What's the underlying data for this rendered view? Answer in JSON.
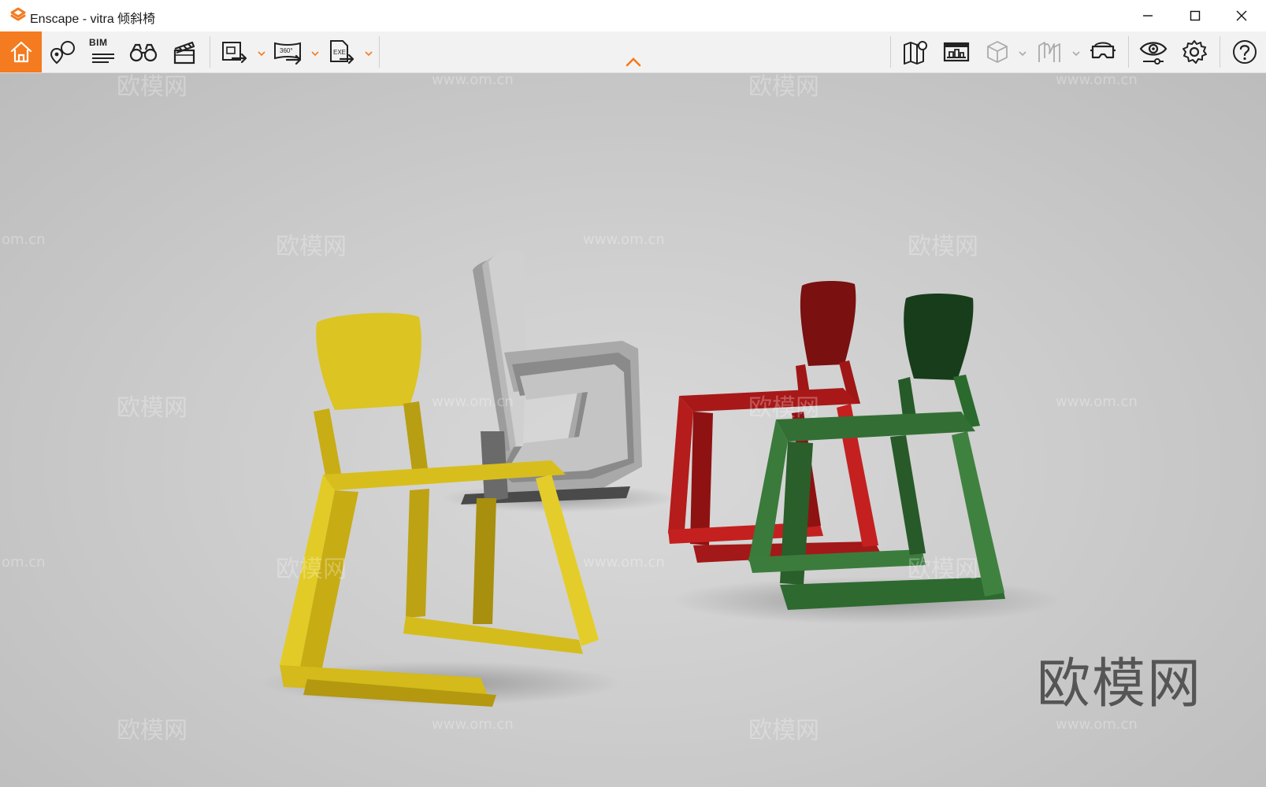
{
  "window": {
    "title": "Enscape - vitra 倾斜椅",
    "controls": [
      "minimize",
      "maximize",
      "close"
    ]
  },
  "toolbar": {
    "bim_label": "BIM",
    "left_tools": [
      {
        "name": "home-button",
        "icon": "home-icon",
        "active": true
      },
      {
        "name": "views-button",
        "icon": "map-pin-icon"
      },
      {
        "name": "bim-button",
        "icon": "bim-icon"
      },
      {
        "name": "binoculars-button",
        "icon": "binoculars-icon"
      },
      {
        "name": "video-editor-button",
        "icon": "clapperboard-icon"
      },
      {
        "name": "export-image-button",
        "icon": "export-image-icon",
        "dropdown": true
      },
      {
        "name": "export-360-button",
        "icon": "panorama-360-icon",
        "dropdown": true
      },
      {
        "name": "export-exe-button",
        "icon": "export-exe-icon",
        "dropdown": true
      }
    ],
    "right_tools": [
      {
        "name": "map-button",
        "icon": "map-icon"
      },
      {
        "name": "asset-library-button",
        "icon": "asset-library-icon"
      },
      {
        "name": "cube-view-button",
        "icon": "cube-icon",
        "dropdown": true,
        "disabled": true
      },
      {
        "name": "section-button",
        "icon": "section-icon",
        "dropdown": true,
        "disabled": true
      },
      {
        "name": "vr-headset-button",
        "icon": "vr-headset-icon"
      },
      {
        "name": "visual-settings-button",
        "icon": "eye-icon"
      },
      {
        "name": "settings-button",
        "icon": "gear-icon"
      },
      {
        "name": "help-button",
        "icon": "help-icon"
      }
    ],
    "accent_color": "#f47b20"
  },
  "viewport": {
    "watermark_text": "欧模网",
    "watermark_url": "www.om.cn",
    "watermark_url_partial": "om.cn",
    "big_watermark": "欧模网",
    "chairs": [
      {
        "color_name": "yellow",
        "color": "#d9c21e"
      },
      {
        "color_name": "grey stack",
        "color": "#8a8a8a"
      },
      {
        "color_name": "red",
        "color": "#b01a1a"
      },
      {
        "color_name": "green",
        "color": "#2f6e30"
      }
    ]
  }
}
